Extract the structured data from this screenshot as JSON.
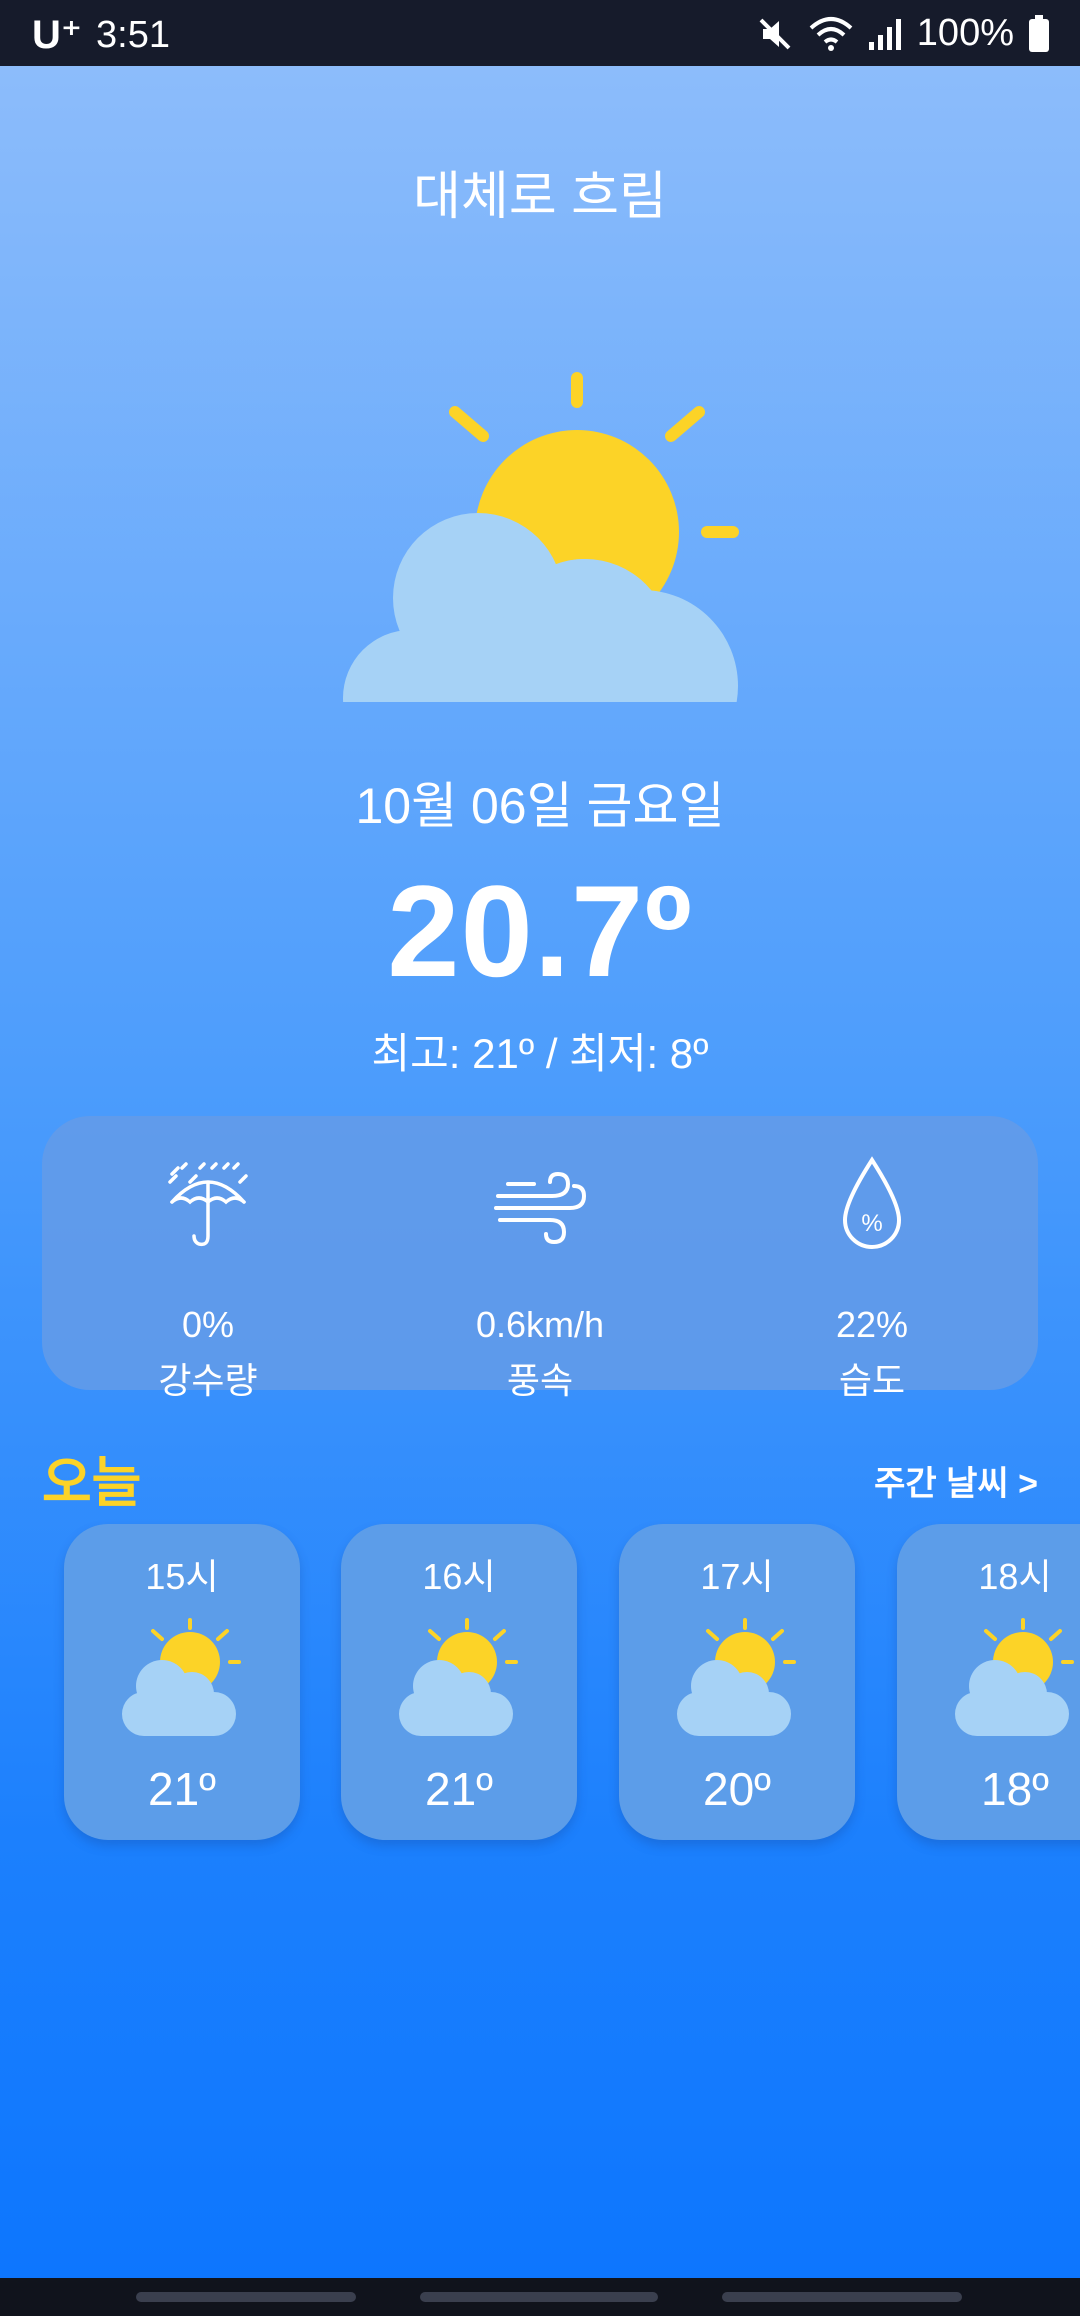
{
  "status_bar": {
    "carrier": "U⁺",
    "time": "3:51",
    "battery": "100%"
  },
  "weather": {
    "condition": "대체로 흐림",
    "date": "10월 06일 금요일",
    "temperature": "20.7º",
    "min_max": "최고: 21º / 최저: 8º"
  },
  "stats": [
    {
      "icon": "umbrella-rain-icon",
      "value": "0%",
      "label": "강수량"
    },
    {
      "icon": "wind-icon",
      "value": "0.6km/h",
      "label": "풍속"
    },
    {
      "icon": "humidity-drop-icon",
      "value": "22%",
      "label": "습도"
    }
  ],
  "today": {
    "title": "오늘",
    "weekly_link": "주간 날씨 >",
    "hours": [
      {
        "time": "15시",
        "temp": "21º",
        "icon": "partly-cloudy-icon"
      },
      {
        "time": "16시",
        "temp": "21º",
        "icon": "partly-cloudy-icon"
      },
      {
        "time": "17시",
        "temp": "20º",
        "icon": "partly-cloudy-icon"
      },
      {
        "time": "18시",
        "temp": "18º",
        "icon": "partly-cloudy-icon"
      }
    ]
  },
  "colors": {
    "sun": "#fcd327",
    "cloud": "#a6d2f6",
    "accent_today": "#fcd327",
    "card": "#5c9de9"
  }
}
